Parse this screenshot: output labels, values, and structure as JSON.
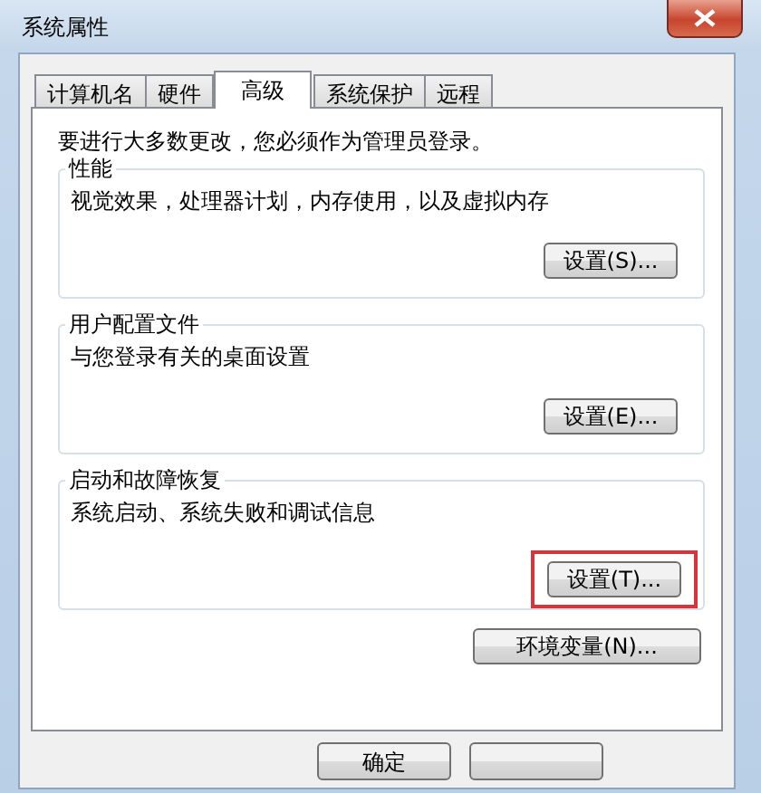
{
  "window": {
    "title": "系统属性"
  },
  "tabs": [
    {
      "label": "计算机名",
      "selected": false
    },
    {
      "label": "硬件",
      "selected": false
    },
    {
      "label": "高级",
      "selected": true
    },
    {
      "label": "系统保护",
      "selected": false
    },
    {
      "label": "远程",
      "selected": false
    }
  ],
  "notice": "要进行大多数更改，您必须作为管理员登录。",
  "groups": [
    {
      "title": "性能",
      "description": "视觉效果，处理器计划，内存使用，以及虚拟内存",
      "button": {
        "label": "设置(S)...",
        "highlighted": false
      }
    },
    {
      "title": "用户配置文件",
      "description": "与您登录有关的桌面设置",
      "button": {
        "label": "设置(E)...",
        "highlighted": false
      }
    },
    {
      "title": "启动和故障恢复",
      "description": "系统启动、系统失败和调试信息",
      "button": {
        "label": "设置(T)...",
        "highlighted": true
      }
    }
  ],
  "env_button": "环境变量(N)...",
  "footer_buttons": [
    {
      "kind": "labeled",
      "label": "确定"
    },
    {
      "kind": "blank"
    }
  ]
}
